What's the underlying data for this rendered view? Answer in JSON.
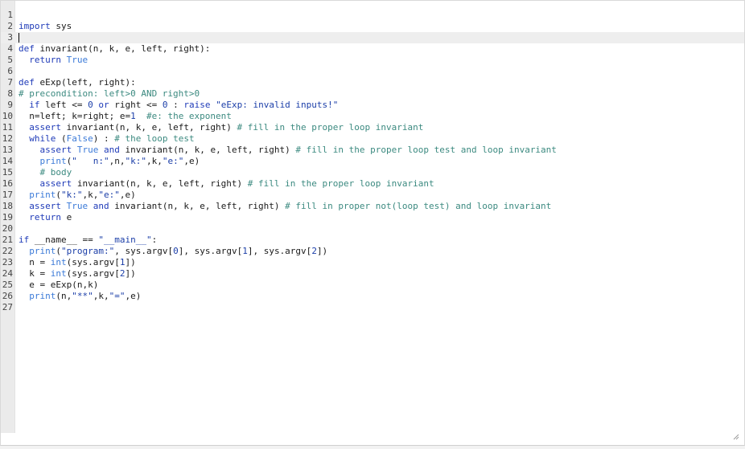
{
  "editor": {
    "lines": [
      {
        "n": "1",
        "t": [],
        "active": false
      },
      {
        "n": "2",
        "t": [
          {
            "c": "kw",
            "v": "import"
          },
          {
            "c": "",
            "v": " sys"
          }
        ]
      },
      {
        "n": "3",
        "t": [],
        "active": true
      },
      {
        "n": "4",
        "t": [
          {
            "c": "kw",
            "v": "def"
          },
          {
            "c": "",
            "v": " invariant(n, k, e, left, right):"
          }
        ]
      },
      {
        "n": "5",
        "t": [
          {
            "c": "",
            "v": "  "
          },
          {
            "c": "kw",
            "v": "return"
          },
          {
            "c": "",
            "v": " "
          },
          {
            "c": "bi",
            "v": "True"
          }
        ]
      },
      {
        "n": "6",
        "t": []
      },
      {
        "n": "7",
        "t": [
          {
            "c": "kw",
            "v": "def"
          },
          {
            "c": "",
            "v": " eExp(left, right):"
          }
        ]
      },
      {
        "n": "8",
        "t": [
          {
            "c": "cm",
            "v": "# precondition: left>0 AND right>0"
          }
        ]
      },
      {
        "n": "9",
        "t": [
          {
            "c": "",
            "v": "  "
          },
          {
            "c": "kw",
            "v": "if"
          },
          {
            "c": "",
            "v": " left <= "
          },
          {
            "c": "num",
            "v": "0"
          },
          {
            "c": "",
            "v": " "
          },
          {
            "c": "kw",
            "v": "or"
          },
          {
            "c": "",
            "v": " right <= "
          },
          {
            "c": "num",
            "v": "0"
          },
          {
            "c": "",
            "v": " : "
          },
          {
            "c": "kw",
            "v": "raise"
          },
          {
            "c": "",
            "v": " "
          },
          {
            "c": "str",
            "v": "\"eExp: invalid inputs!\""
          }
        ]
      },
      {
        "n": "10",
        "t": [
          {
            "c": "",
            "v": "  n=left; k=right; e="
          },
          {
            "c": "num",
            "v": "1"
          },
          {
            "c": "",
            "v": "  "
          },
          {
            "c": "cm",
            "v": "#e: the exponent"
          }
        ]
      },
      {
        "n": "11",
        "t": [
          {
            "c": "",
            "v": "  "
          },
          {
            "c": "kw",
            "v": "assert"
          },
          {
            "c": "",
            "v": " invariant(n, k, e, left, right) "
          },
          {
            "c": "cm",
            "v": "# fill in the proper loop invariant"
          }
        ]
      },
      {
        "n": "12",
        "t": [
          {
            "c": "",
            "v": "  "
          },
          {
            "c": "kw",
            "v": "while"
          },
          {
            "c": "",
            "v": " ("
          },
          {
            "c": "bi",
            "v": "False"
          },
          {
            "c": "",
            "v": ") : "
          },
          {
            "c": "cm",
            "v": "# the loop test"
          }
        ]
      },
      {
        "n": "13",
        "t": [
          {
            "c": "",
            "v": "    "
          },
          {
            "c": "kw",
            "v": "assert"
          },
          {
            "c": "",
            "v": " "
          },
          {
            "c": "bi",
            "v": "True"
          },
          {
            "c": "",
            "v": " "
          },
          {
            "c": "kw",
            "v": "and"
          },
          {
            "c": "",
            "v": " invariant(n, k, e, left, right) "
          },
          {
            "c": "cm",
            "v": "# fill in the proper loop test and loop invariant"
          }
        ]
      },
      {
        "n": "14",
        "t": [
          {
            "c": "",
            "v": "    "
          },
          {
            "c": "bi",
            "v": "print"
          },
          {
            "c": "",
            "v": "("
          },
          {
            "c": "str",
            "v": "\"   n:\""
          },
          {
            "c": "",
            "v": ",n,"
          },
          {
            "c": "str",
            "v": "\"k:\""
          },
          {
            "c": "",
            "v": ",k,"
          },
          {
            "c": "str",
            "v": "\"e:\""
          },
          {
            "c": "",
            "v": ",e)"
          }
        ]
      },
      {
        "n": "15",
        "t": [
          {
            "c": "",
            "v": "    "
          },
          {
            "c": "cm",
            "v": "# body"
          }
        ]
      },
      {
        "n": "16",
        "t": [
          {
            "c": "",
            "v": "    "
          },
          {
            "c": "kw",
            "v": "assert"
          },
          {
            "c": "",
            "v": " invariant(n, k, e, left, right) "
          },
          {
            "c": "cm",
            "v": "# fill in the proper loop invariant"
          }
        ]
      },
      {
        "n": "17",
        "t": [
          {
            "c": "",
            "v": "  "
          },
          {
            "c": "bi",
            "v": "print"
          },
          {
            "c": "",
            "v": "("
          },
          {
            "c": "str",
            "v": "\"k:\""
          },
          {
            "c": "",
            "v": ",k,"
          },
          {
            "c": "str",
            "v": "\"e:\""
          },
          {
            "c": "",
            "v": ",e)"
          }
        ]
      },
      {
        "n": "18",
        "t": [
          {
            "c": "",
            "v": "  "
          },
          {
            "c": "kw",
            "v": "assert"
          },
          {
            "c": "",
            "v": " "
          },
          {
            "c": "bi",
            "v": "True"
          },
          {
            "c": "",
            "v": " "
          },
          {
            "c": "kw",
            "v": "and"
          },
          {
            "c": "",
            "v": " invariant(n, k, e, left, right) "
          },
          {
            "c": "cm",
            "v": "# fill in proper not(loop test) and loop invariant"
          }
        ]
      },
      {
        "n": "19",
        "t": [
          {
            "c": "",
            "v": "  "
          },
          {
            "c": "kw",
            "v": "return"
          },
          {
            "c": "",
            "v": " e"
          }
        ]
      },
      {
        "n": "20",
        "t": []
      },
      {
        "n": "21",
        "t": [
          {
            "c": "kw",
            "v": "if"
          },
          {
            "c": "",
            "v": " __name__ == "
          },
          {
            "c": "str",
            "v": "\"__main__\""
          },
          {
            "c": "",
            "v": ":"
          }
        ]
      },
      {
        "n": "22",
        "t": [
          {
            "c": "",
            "v": "  "
          },
          {
            "c": "bi",
            "v": "print"
          },
          {
            "c": "",
            "v": "("
          },
          {
            "c": "str",
            "v": "\"program:\""
          },
          {
            "c": "",
            "v": ", sys.argv["
          },
          {
            "c": "num",
            "v": "0"
          },
          {
            "c": "",
            "v": "], sys.argv["
          },
          {
            "c": "num",
            "v": "1"
          },
          {
            "c": "",
            "v": "], sys.argv["
          },
          {
            "c": "num",
            "v": "2"
          },
          {
            "c": "",
            "v": "])"
          }
        ]
      },
      {
        "n": "23",
        "t": [
          {
            "c": "",
            "v": "  n = "
          },
          {
            "c": "bi",
            "v": "int"
          },
          {
            "c": "",
            "v": "(sys.argv["
          },
          {
            "c": "num",
            "v": "1"
          },
          {
            "c": "",
            "v": "])"
          }
        ]
      },
      {
        "n": "24",
        "t": [
          {
            "c": "",
            "v": "  k = "
          },
          {
            "c": "bi",
            "v": "int"
          },
          {
            "c": "",
            "v": "(sys.argv["
          },
          {
            "c": "num",
            "v": "2"
          },
          {
            "c": "",
            "v": "])"
          }
        ]
      },
      {
        "n": "25",
        "t": [
          {
            "c": "",
            "v": "  e = eExp(n,k)"
          }
        ]
      },
      {
        "n": "26",
        "t": [
          {
            "c": "",
            "v": "  "
          },
          {
            "c": "bi",
            "v": "print"
          },
          {
            "c": "",
            "v": "(n,"
          },
          {
            "c": "str",
            "v": "\"**\""
          },
          {
            "c": "",
            "v": ",k,"
          },
          {
            "c": "str",
            "v": "\"=\""
          },
          {
            "c": "",
            "v": ",e)"
          }
        ]
      },
      {
        "n": "27",
        "t": []
      }
    ],
    "cursor_line": "3",
    "resize_icon": "resize-grip-icon"
  }
}
